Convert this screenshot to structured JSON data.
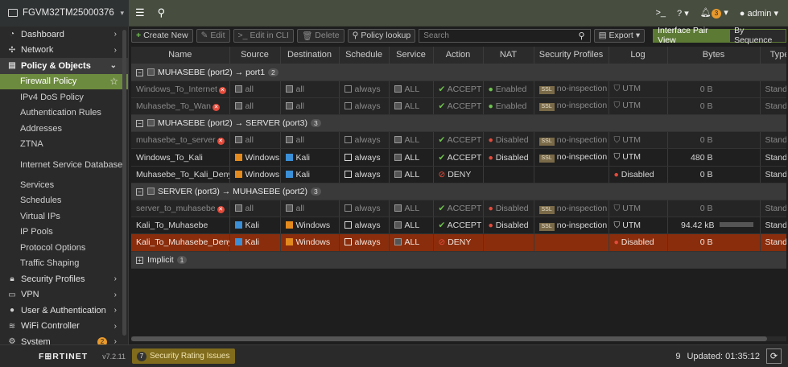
{
  "topbar": {
    "device_name": "FGVM32TM25000376",
    "menu_icon": "hamburger-icon",
    "search_icon": "search-icon",
    "cli_label": ">_",
    "help_label": "?",
    "alerts_count": "3",
    "user": "admin"
  },
  "sidebar": {
    "items": [
      {
        "label": "Dashboard",
        "icon": "dashboard-icon",
        "chev": "›"
      },
      {
        "label": "Network",
        "icon": "network-icon",
        "chev": "›"
      },
      {
        "label": "Policy & Objects",
        "icon": "policy-icon",
        "chev": "⌄"
      },
      {
        "label": "Firewall Policy"
      },
      {
        "label": "IPv4 DoS Policy"
      },
      {
        "label": "Authentication Rules"
      },
      {
        "label": "Addresses"
      },
      {
        "label": "ZTNA"
      },
      {
        "label": "Internet Service Database"
      },
      {
        "label": "Services"
      },
      {
        "label": "Schedules"
      },
      {
        "label": "Virtual IPs"
      },
      {
        "label": "IP Pools"
      },
      {
        "label": "Protocol Options"
      },
      {
        "label": "Traffic Shaping"
      },
      {
        "label": "Security Profiles",
        "icon": "lock-icon",
        "chev": "›"
      },
      {
        "label": "VPN",
        "icon": "monitor-icon",
        "chev": "›"
      },
      {
        "label": "User & Authentication",
        "icon": "user-icon",
        "chev": "›"
      },
      {
        "label": "WiFi Controller",
        "icon": "wifi-icon",
        "chev": "›"
      },
      {
        "label": "System",
        "icon": "gear-icon",
        "chev": "›",
        "badge": "2"
      }
    ]
  },
  "toolbar": {
    "create_new": "Create New",
    "edit": "Edit",
    "edit_cli": "Edit in CLI",
    "delete": "Delete",
    "policy_lookup": "Policy lookup",
    "search_placeholder": "Search",
    "export": "Export",
    "view_pair": "Interface Pair View",
    "view_seq": "By Sequence"
  },
  "table": {
    "columns": [
      "Name",
      "Source",
      "Destination",
      "Schedule",
      "Service",
      "Action",
      "NAT",
      "Security Profiles",
      "Log",
      "Bytes",
      "Type"
    ],
    "groups": [
      {
        "label": "MUHASEBE (port2) → port1",
        "count": "2",
        "rows": [
          {
            "name": "Windows_To_Internet",
            "disabled": true,
            "source": "all",
            "dest": "all",
            "schedule": "always",
            "service": "ALL",
            "action": "ACCEPT",
            "nat": "Enabled",
            "profile": "no-inspection",
            "log": "UTM",
            "bytes": "0 B",
            "type": "Standard"
          },
          {
            "name": "Muhasebe_To_Wan",
            "disabled": true,
            "source": "all",
            "dest": "all",
            "schedule": "always",
            "service": "ALL",
            "action": "ACCEPT",
            "nat": "Enabled",
            "profile": "no-inspection",
            "log": "UTM",
            "bytes": "0 B",
            "type": "Standard"
          }
        ]
      },
      {
        "label": "MUHASEBE (port2) → SERVER (port3)",
        "count": "3",
        "rows": [
          {
            "name": "muhasebe_to_server",
            "disabled": true,
            "source": "all",
            "dest": "all",
            "schedule": "always",
            "service": "ALL",
            "action": "ACCEPT",
            "nat": "Disabled",
            "profile": "no-inspection",
            "log": "UTM",
            "bytes": "0 B",
            "type": "Standard"
          },
          {
            "name": "Windows_To_Kali",
            "disabled": false,
            "source": "Windows",
            "dest": "Kali",
            "schedule": "always",
            "service": "ALL",
            "action": "ACCEPT",
            "nat": "Disabled",
            "profile": "no-inspection",
            "log": "UTM",
            "bytes": "480 B",
            "type": "Standard"
          },
          {
            "name": "Muhasebe_To_Kali_Deny",
            "disabled": false,
            "source": "Windows",
            "dest": "Kali",
            "schedule": "always",
            "service": "ALL",
            "action": "DENY",
            "nat": "",
            "profile": "",
            "log": "Disabled",
            "bytes": "0 B",
            "type": "Standard"
          }
        ]
      },
      {
        "label": "SERVER (port3) → MUHASEBE (port2)",
        "count": "3",
        "rows": [
          {
            "name": "server_to_muhasebe",
            "disabled": true,
            "source": "all",
            "dest": "all",
            "schedule": "always",
            "service": "ALL",
            "action": "ACCEPT",
            "nat": "Disabled",
            "profile": "no-inspection",
            "log": "UTM",
            "bytes": "0 B",
            "type": "Standard"
          },
          {
            "name": "Kali_To_Muhasebe",
            "disabled": false,
            "source": "Kali",
            "dest": "Windows",
            "schedule": "always",
            "service": "ALL",
            "action": "ACCEPT",
            "nat": "Disabled",
            "profile": "no-inspection",
            "log": "UTM",
            "bytes": "94.42 kB",
            "type": "Standard"
          },
          {
            "name": "Kali_To_Muhasebe_Deny",
            "disabled": false,
            "selected": true,
            "source": "Kali",
            "dest": "Windows",
            "schedule": "always",
            "service": "ALL",
            "action": "DENY",
            "nat": "",
            "profile": "",
            "log": "Disabled",
            "bytes": "0 B",
            "type": "Standard"
          }
        ]
      },
      {
        "label": "Implicit",
        "count": "1",
        "collapsed": true,
        "rows": []
      }
    ]
  },
  "bottombar": {
    "logo": "F⊞RTINET",
    "version": "v7.2.11",
    "security_rating_count": "7",
    "security_rating_label": "Security Rating Issues",
    "row_count": "9",
    "updated": "Updated: 01:35:12"
  },
  "colors": {
    "accent_green": "#6d8b3e",
    "selected_row": "#8a2d0c",
    "deny_red": "#e24b3b",
    "accept_green": "#6fc24f"
  }
}
